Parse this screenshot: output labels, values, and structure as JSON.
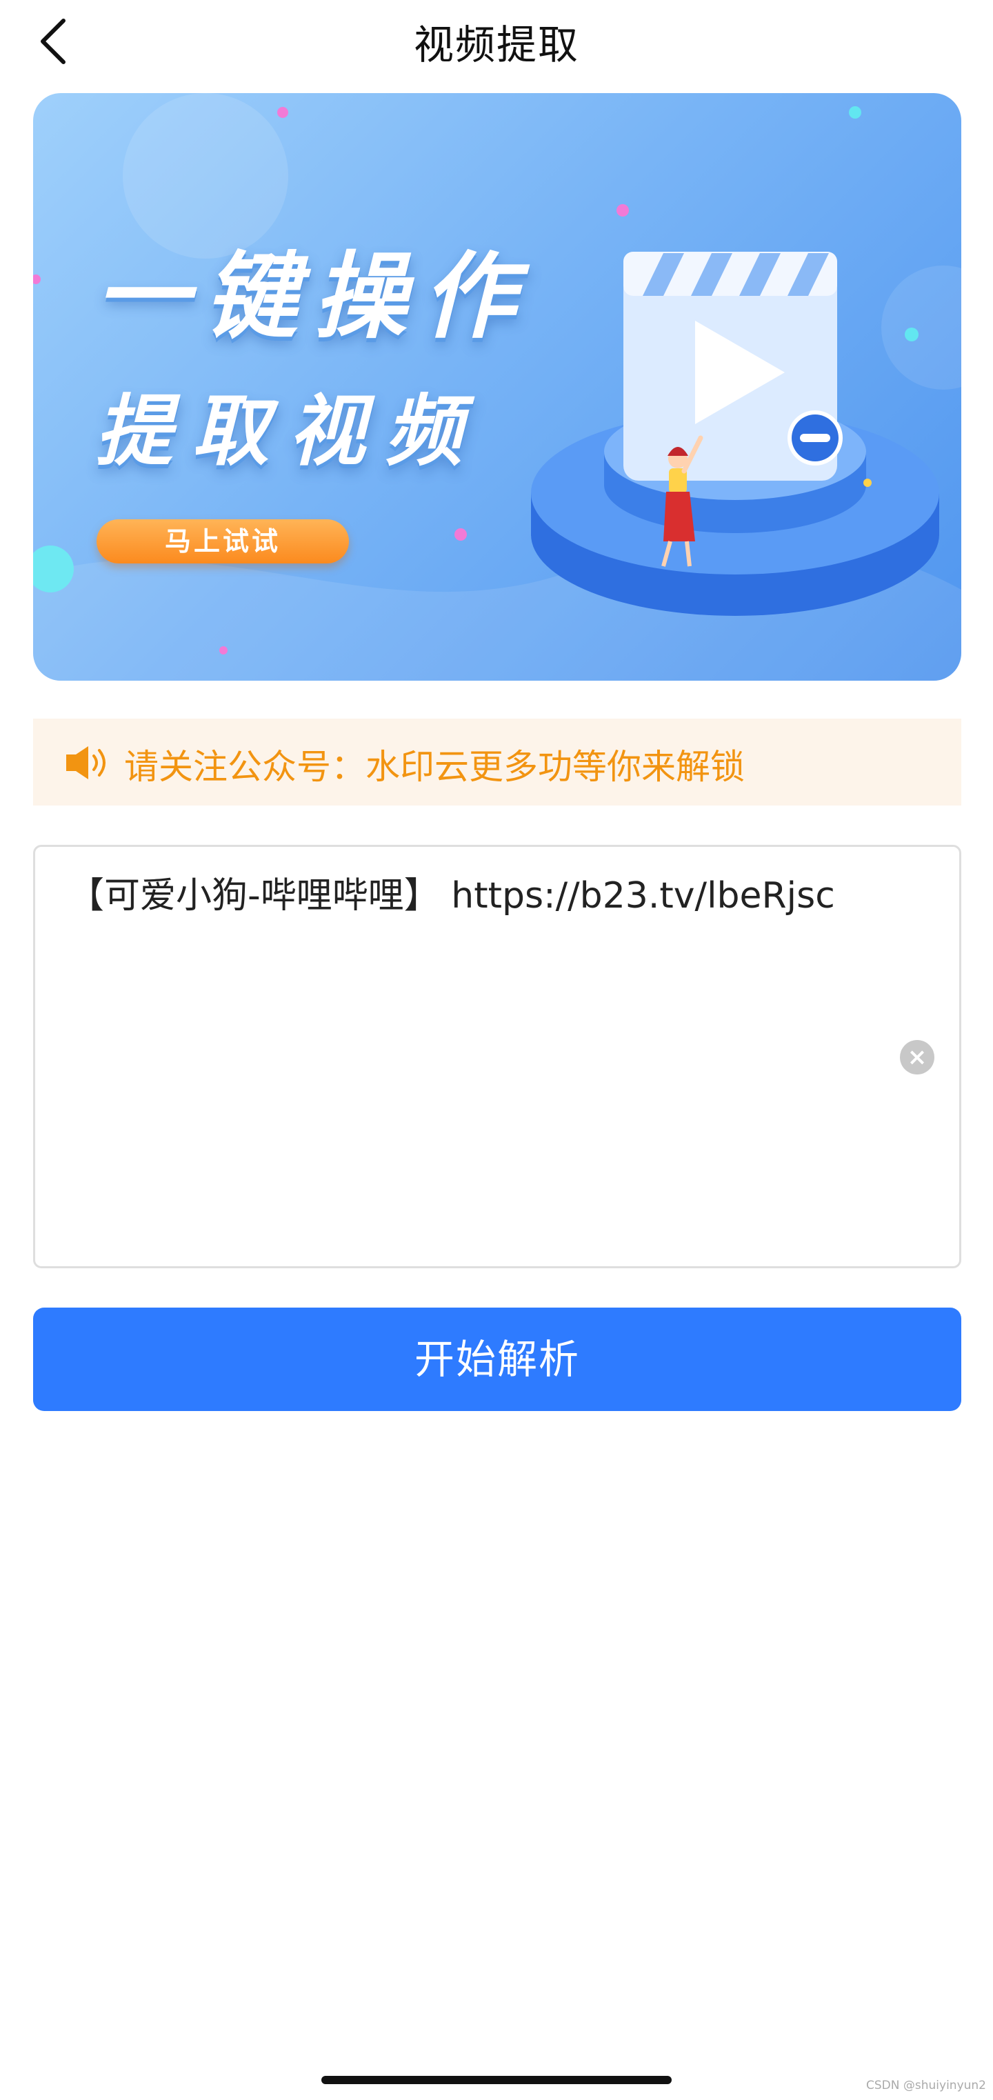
{
  "header": {
    "title": "视频提取",
    "back_icon": "chevron-left-icon"
  },
  "banner": {
    "headline": "一键操作",
    "subheadline": "提取视频",
    "cta_label": "马上试试",
    "colors": {
      "bg_light": "#9fd0fb",
      "bg_dark": "#4f95ef",
      "cta": "#fb8a1e"
    }
  },
  "notice": {
    "icon": "speaker-icon",
    "text": "请关注公众号：水印云更多功等你来解锁",
    "color": "#f29411",
    "background": "#fdf4ea"
  },
  "link_input": {
    "value": "【可爱小狗-哔哩哔哩】 https://b23.tv/lbeRjsc",
    "clear_icon": "clear-icon"
  },
  "submit": {
    "label": "开始解析",
    "color": "#2e7bff"
  },
  "footer": {
    "watermark": "CSDN @shuiyinyun2"
  }
}
